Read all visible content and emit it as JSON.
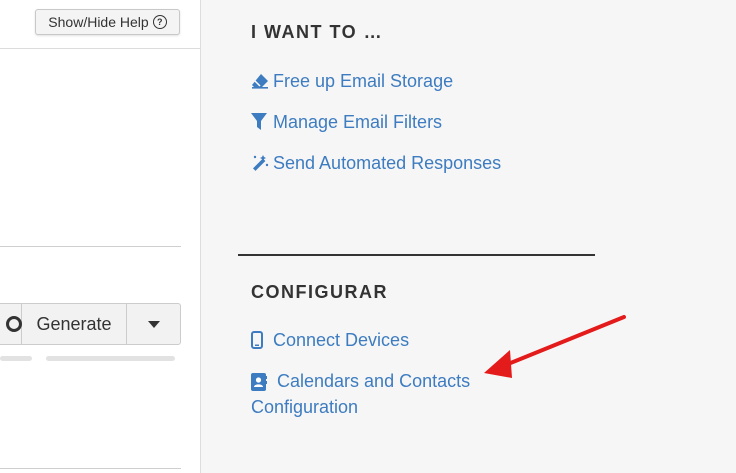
{
  "left": {
    "help_button": "Show/Hide Help",
    "help_icon": "?",
    "generate_button": "Generate",
    "icons": [
      "search-icon",
      "caret-down-icon"
    ]
  },
  "right": {
    "section1": {
      "title": "I WANT TO …",
      "links": [
        {
          "label": "Free up Email Storage",
          "icon": "eraser-icon"
        },
        {
          "label": "Manage Email Filters",
          "icon": "filter-icon"
        },
        {
          "label": "Send Automated Responses",
          "icon": "magic-wand-icon"
        }
      ]
    },
    "section2": {
      "title": "CONFIGURAR",
      "links": [
        {
          "label": "Connect Devices",
          "icon": "mobile-icon"
        },
        {
          "label": "Calendars and Contacts Configuration",
          "icon": "address-book-icon"
        }
      ]
    }
  },
  "colors": {
    "link": "#3d7cc0",
    "panel_bg": "#f6f6f6",
    "annotation_arrow": "#e41b1b"
  }
}
